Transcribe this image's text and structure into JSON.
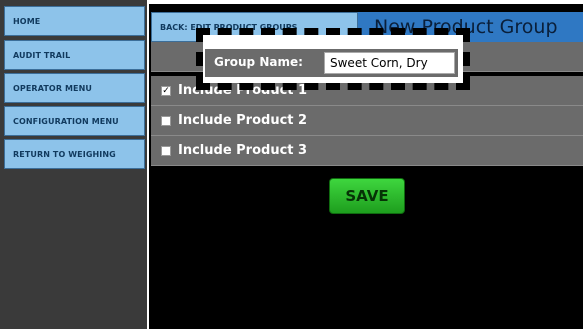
{
  "sidebar": {
    "items": [
      {
        "label": "HOME"
      },
      {
        "label": "AUDIT TRAIL"
      },
      {
        "label": "OPERATOR MENU"
      },
      {
        "label": "CONFIGURATION MENU"
      },
      {
        "label": "RETURN TO WEIGHING"
      }
    ]
  },
  "header": {
    "back_label": "BACK: EDIT PRODUCT GROUPS",
    "title": "New Product Group"
  },
  "group": {
    "label": "Group Name:",
    "value": "Sweet Corn, Dry"
  },
  "products": [
    {
      "label": "Include Product 1",
      "checked": true,
      "mark": "✓"
    },
    {
      "label": "Include Product 2",
      "checked": false,
      "mark": ""
    },
    {
      "label": "Include Product 3",
      "checked": false,
      "mark": ""
    }
  ],
  "save_label": "SAVE",
  "colors": {
    "nav_bg": "#8dc3ea",
    "title_bg": "#2f78c3",
    "row_bg": "#6b6b6b",
    "save_green": "#2bb82b"
  }
}
